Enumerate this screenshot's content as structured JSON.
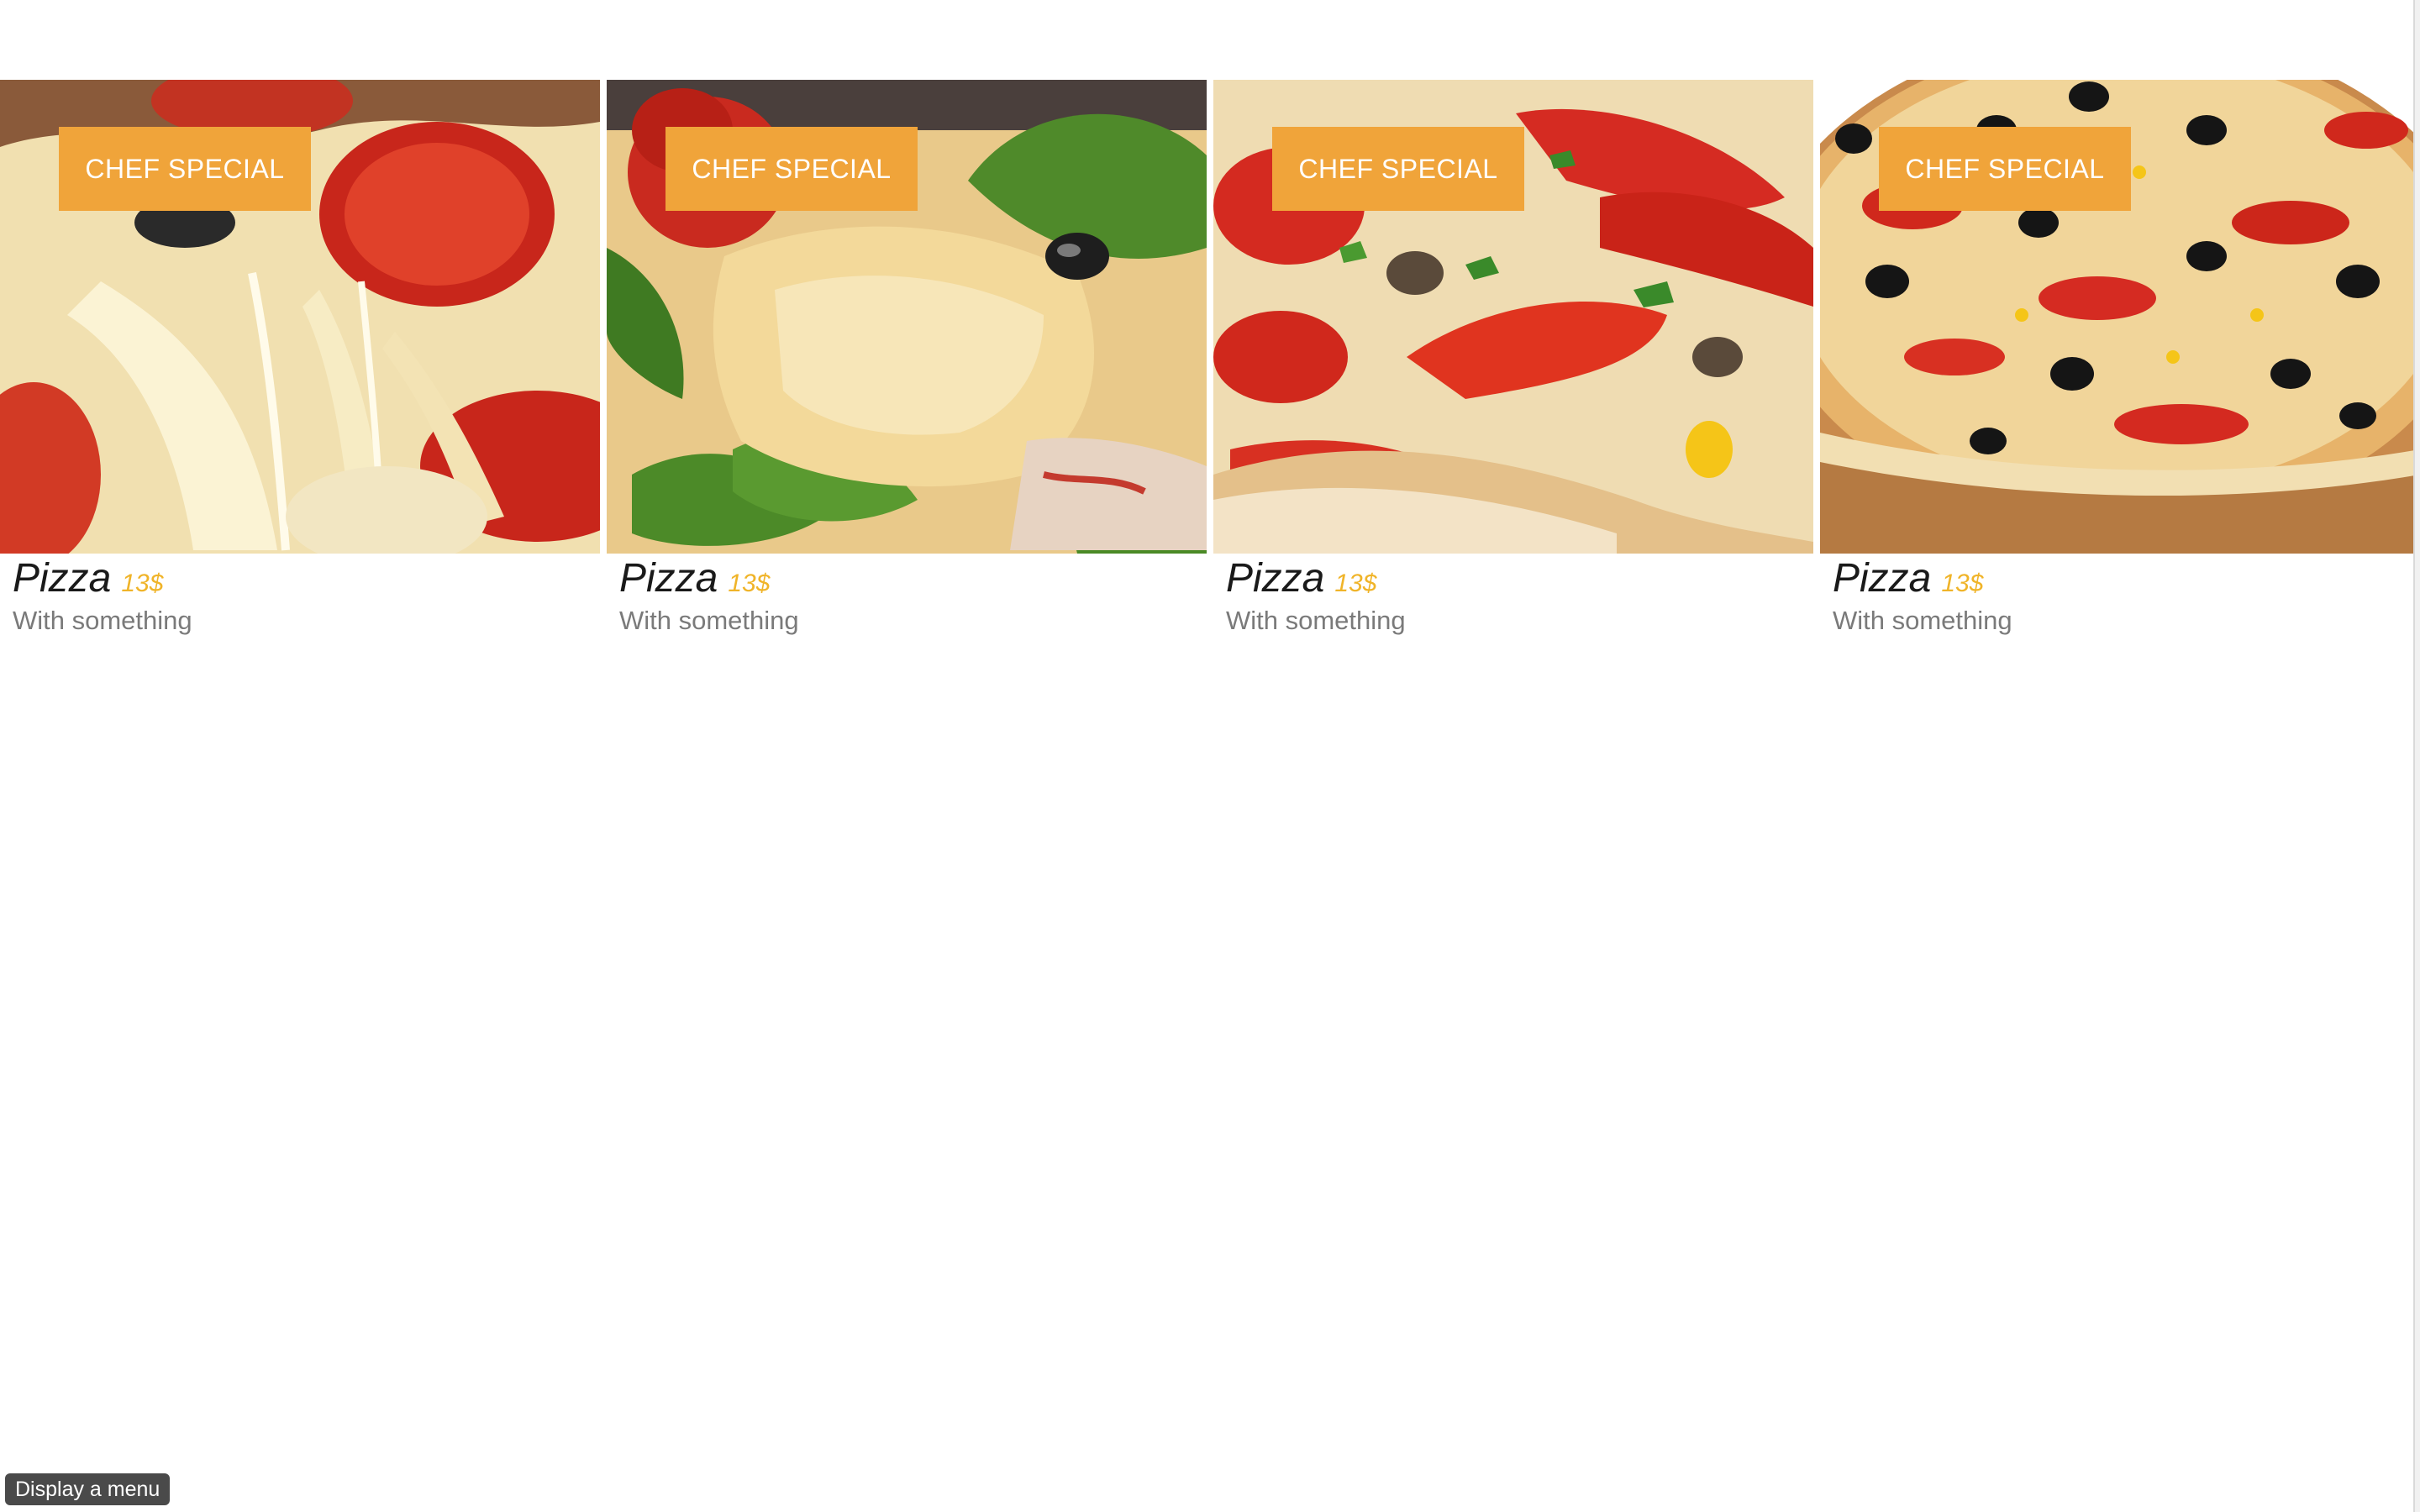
{
  "cards": [
    {
      "badge": "CHEF SPECIAL",
      "title": "Pizza",
      "price": "13$",
      "description": "With something",
      "image": "pizza-cheese-pull-photo"
    },
    {
      "badge": "CHEF SPECIAL",
      "title": "Pizza",
      "price": "13$",
      "description": "With something",
      "image": "pizza-basil-slice-photo"
    },
    {
      "badge": "CHEF SPECIAL",
      "title": "Pizza",
      "price": "13$",
      "description": "With something",
      "image": "pizza-pepper-closeup-photo"
    },
    {
      "badge": "CHEF SPECIAL",
      "title": "Pizza",
      "price": "13$",
      "description": "With something",
      "image": "pizza-olive-whole-photo"
    }
  ],
  "menu_button": {
    "label": "Display a menu"
  },
  "colors": {
    "badge": "#f0a43a",
    "price": "#f0b429",
    "title": "#1a1a1a",
    "description": "#7a7a7a",
    "menu_button_bg": "#4a4a4a"
  }
}
